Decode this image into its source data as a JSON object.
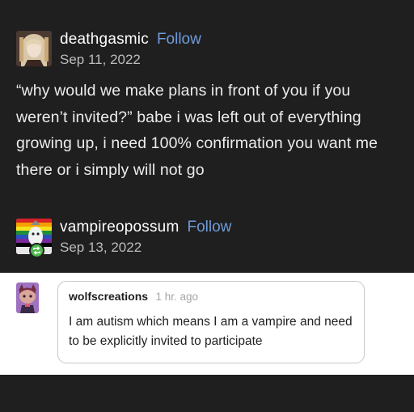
{
  "post1": {
    "username": "deathgasmic",
    "follow_label": "Follow",
    "date": "Sep 11, 2022",
    "body": "“why would we make plans in front of you if you weren’t invited?” babe i was left out of everything growing up, i need 100% confirmation you want me there or i simply will not go"
  },
  "post2": {
    "username": "vampireopossum",
    "follow_label": "Follow",
    "date": "Sep 13, 2022"
  },
  "comment": {
    "username": "wolfscreations",
    "time": "1 hr. ago",
    "text": "I am autism which means I am a vampire and need to be explicitly invited to participate"
  },
  "colors": {
    "background": "#1f1f1f",
    "follow_link": "#6e9bd9",
    "reblog_badge": "#4cb84a",
    "comment_panel": "#ffffff"
  },
  "icons": {
    "reblog": "reblog-icon"
  }
}
